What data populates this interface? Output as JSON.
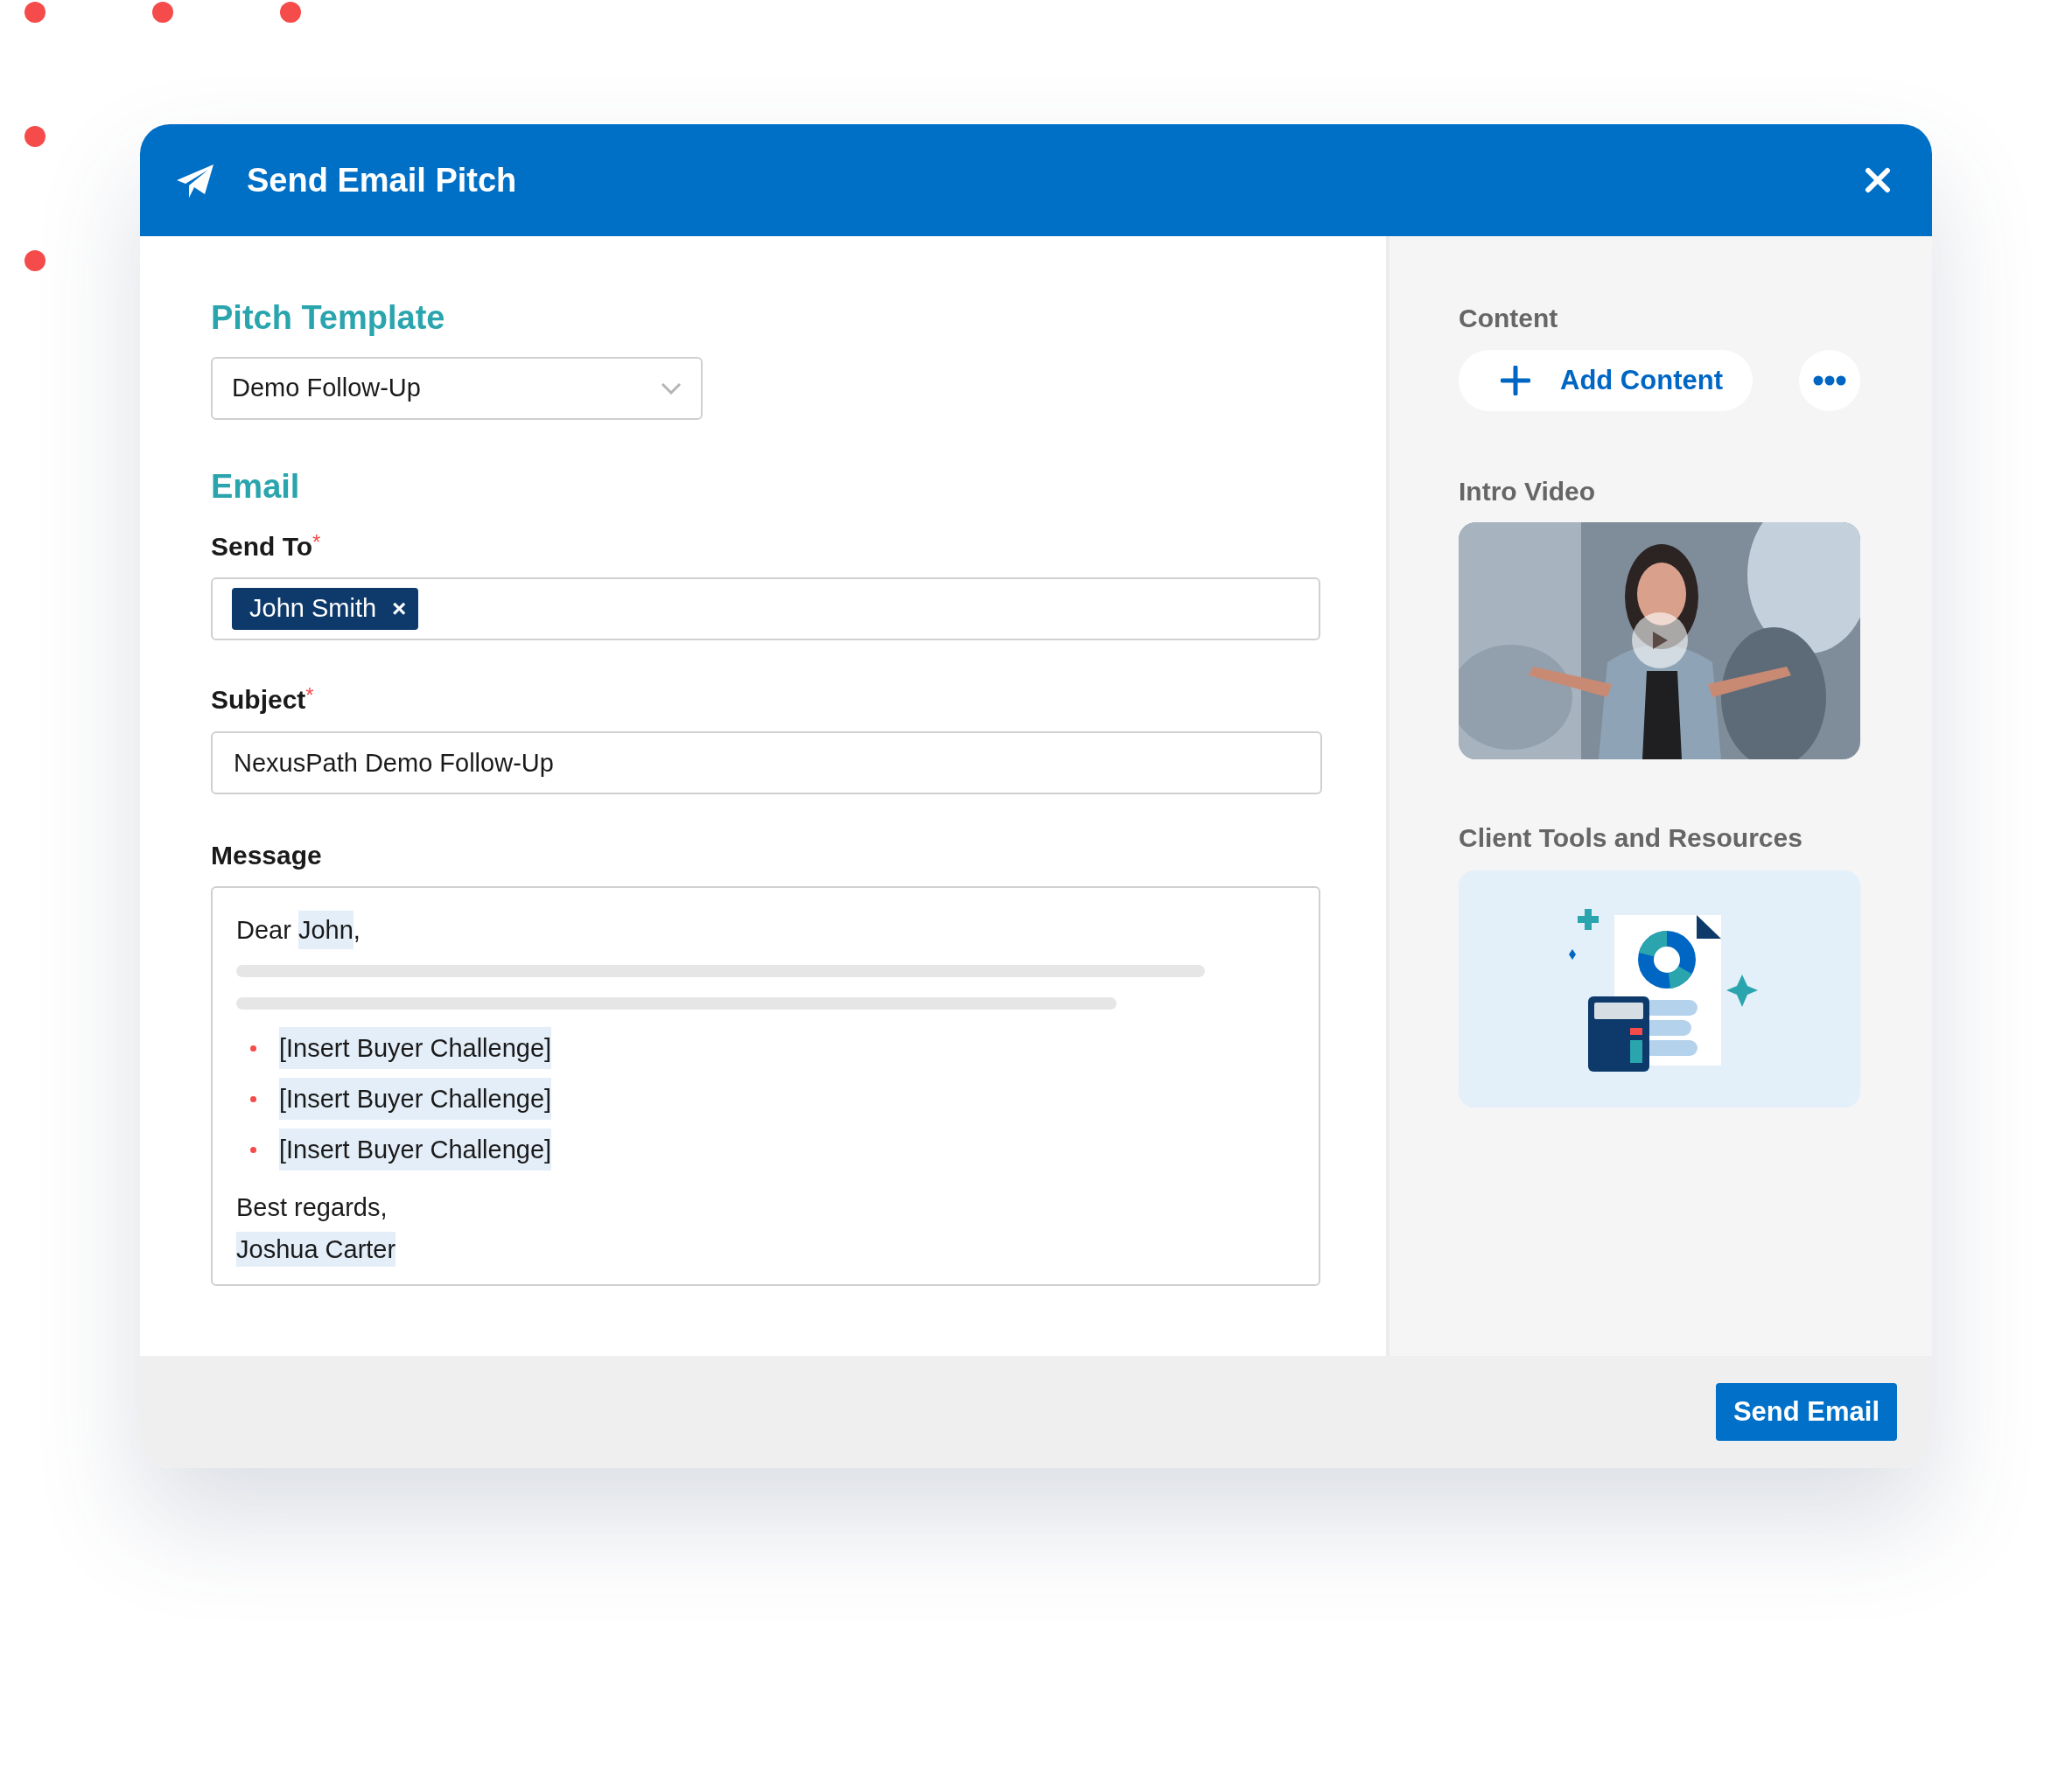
{
  "window": {
    "title": "Send Email Pitch"
  },
  "pitch_template": {
    "heading": "Pitch Template",
    "value": "Demo Follow-Up"
  },
  "email": {
    "heading": "Email",
    "send_to": {
      "label": "Send To",
      "required_mark": "*",
      "recipients": [
        {
          "name": "John Smith",
          "remove": "×"
        }
      ]
    },
    "subject": {
      "label": "Subject",
      "required_mark": "*",
      "value": "NexusPath Demo Follow-Up"
    },
    "message": {
      "label": "Message",
      "greeting": [
        {
          "text": "Dear ",
          "highlighted": false
        },
        {
          "text": "John",
          "highlighted": true
        },
        {
          "text": ",",
          "highlighted": false
        }
      ],
      "bullets": [
        {
          "text": "[Insert Buyer Challenge]",
          "highlighted": true
        },
        {
          "text": "[Insert Buyer Challenge]",
          "highlighted": true
        },
        {
          "text": "[Insert Buyer Challenge]",
          "highlighted": true
        }
      ],
      "closing": [
        {
          "text": "Best regards,",
          "highlighted": false
        },
        {
          "text": "Joshua Carter",
          "highlighted": true
        }
      ]
    }
  },
  "sidebar": {
    "content_label": "Content",
    "add_button": "Add Content",
    "sections": [
      {
        "kind": "video",
        "title": "Intro Video"
      },
      {
        "kind": "illustration",
        "title": "Client Tools and Resources"
      }
    ]
  },
  "footer": {
    "send_button": "Send Email"
  }
}
